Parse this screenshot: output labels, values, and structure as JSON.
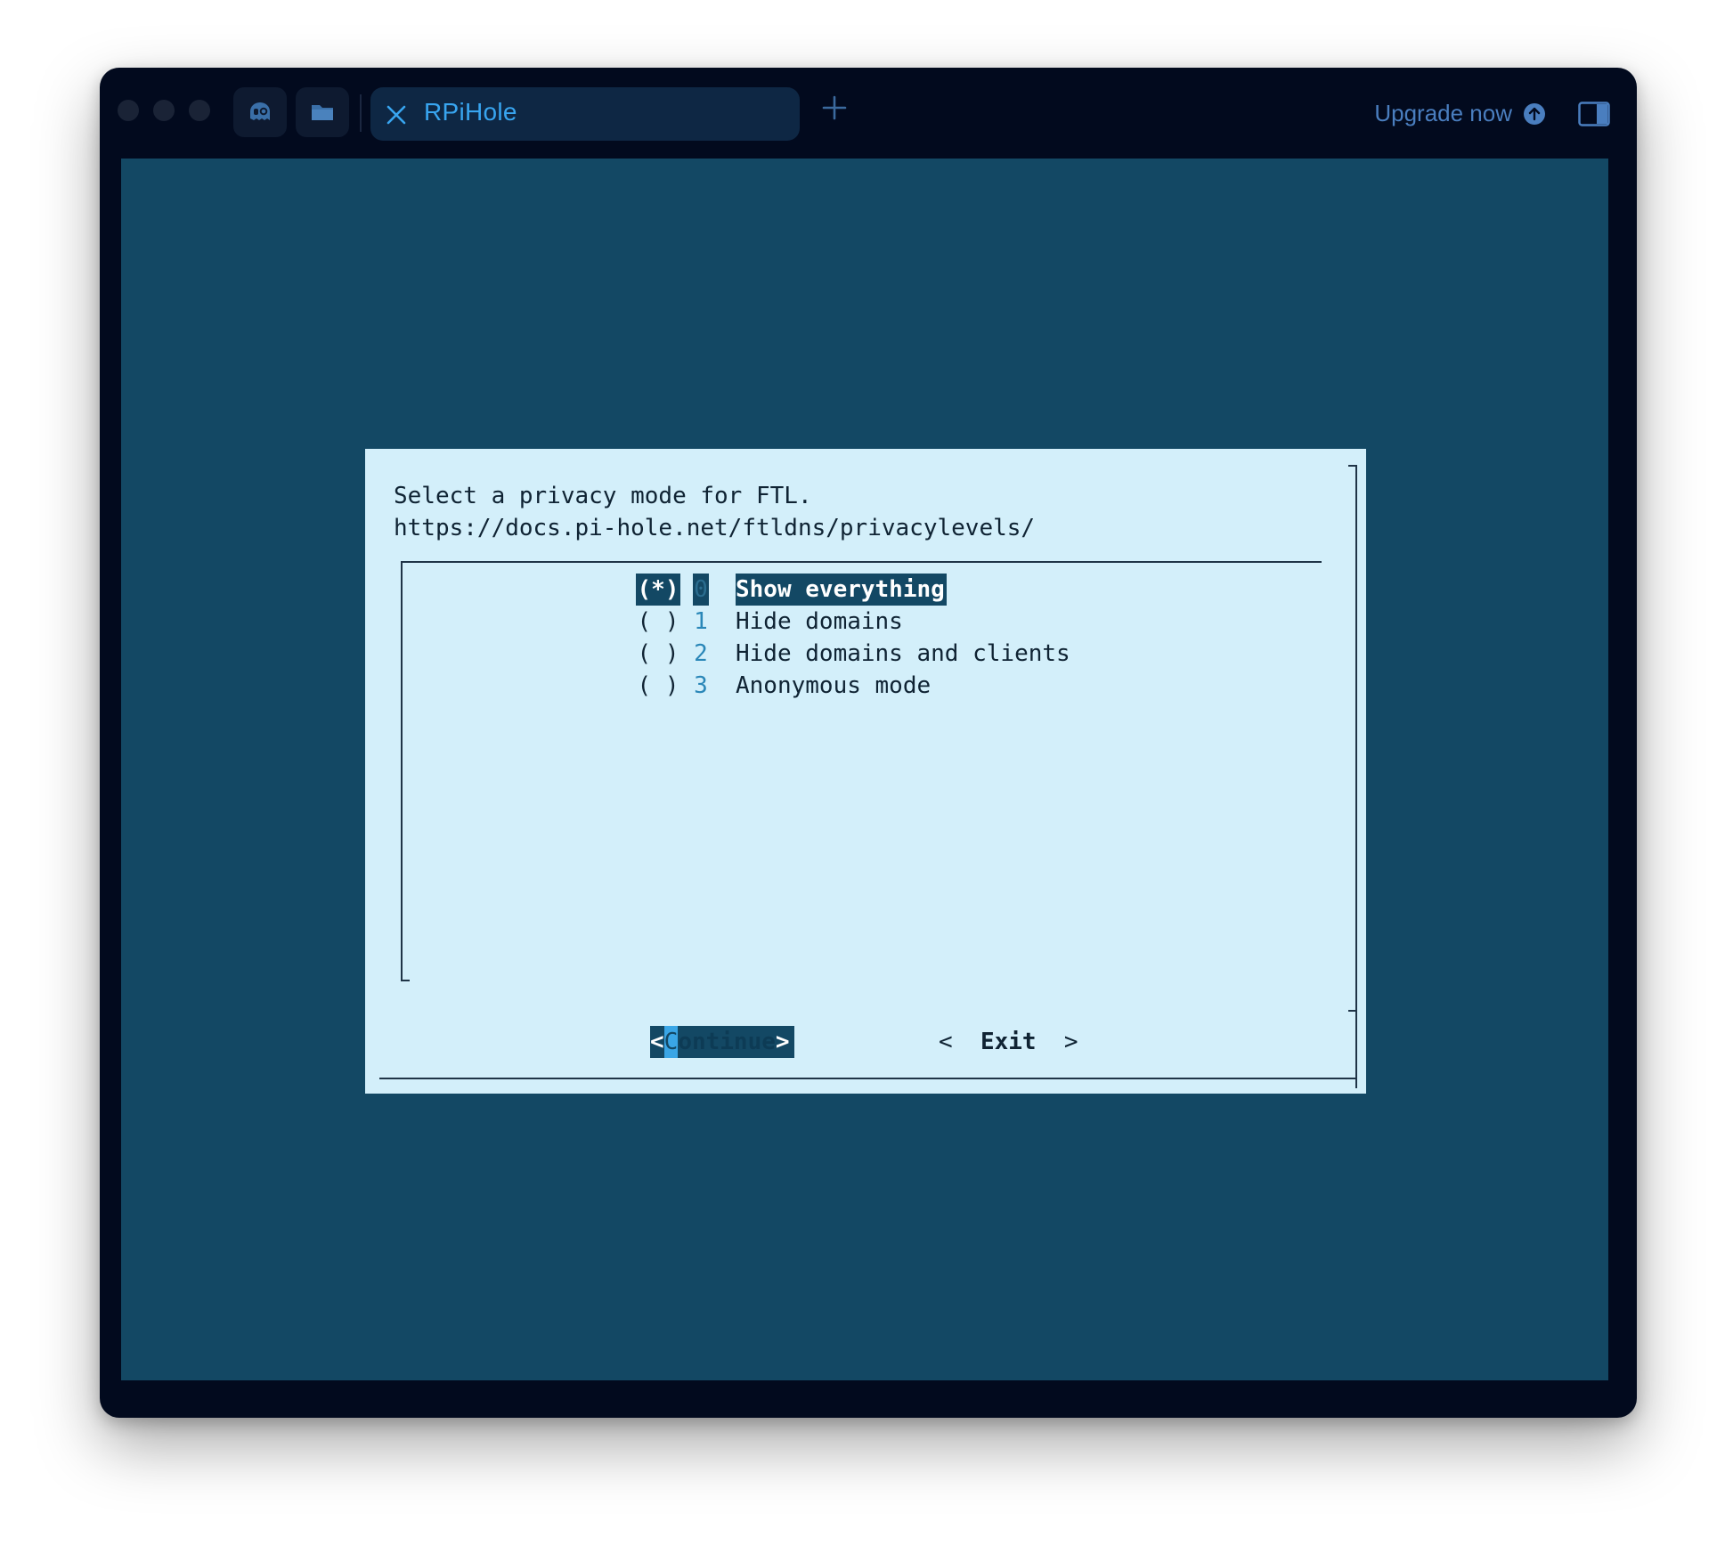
{
  "app": {
    "tab_title": "RPiHole",
    "upgrade_label": "Upgrade now",
    "icons": {
      "traffic_lights": "window-control-dots",
      "toolbar": [
        "ghost-icon",
        "folder-icon"
      ],
      "tab_close": "close-icon",
      "new_tab": "plus-icon",
      "upgrade": "arrow-up-circle-icon",
      "sidebar": "sidebar-toggle-icon"
    }
  },
  "dialog": {
    "message_line1": "Select a privacy mode for FTL.",
    "message_line2": "https://docs.pi-hole.net/ftldns/privacylevels/",
    "options": [
      {
        "radio": "(*)",
        "key": "0",
        "label": "Show everything",
        "selected": true
      },
      {
        "radio": "( )",
        "key": "1",
        "label": "Hide domains",
        "selected": false
      },
      {
        "radio": "( )",
        "key": "2",
        "label": "Hide domains and clients",
        "selected": false
      },
      {
        "radio": "( )",
        "key": "3",
        "label": "Anonymous mode",
        "selected": false
      }
    ],
    "buttons": {
      "continue": {
        "open": "<",
        "hotkey": "C",
        "rest": "ontinue",
        "close": ">"
      },
      "exit": {
        "open": "<",
        "label": "Exit",
        "close": ">"
      }
    }
  },
  "colors": {
    "window_bg": "#020a1e",
    "terminal_bg": "#134864",
    "dialog_bg": "#d3effa",
    "accent": "#38a5f0"
  }
}
